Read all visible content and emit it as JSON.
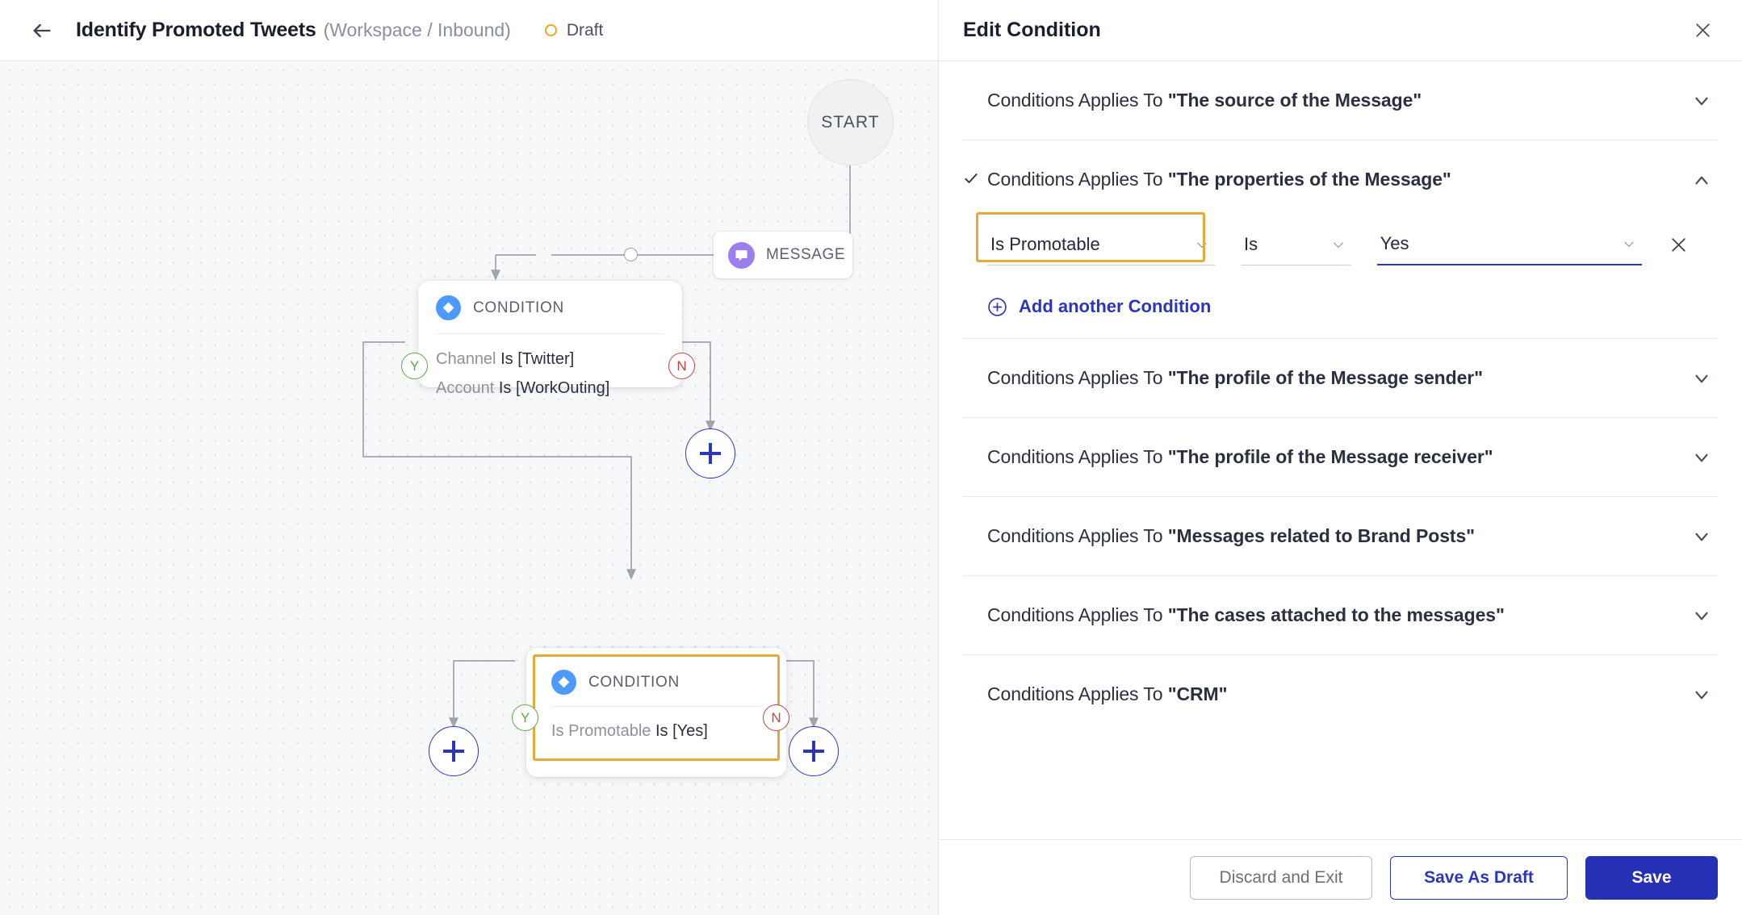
{
  "topbar": {
    "back_icon": "arrow-left-icon",
    "title": "Identify Promoted Tweets",
    "subtitle": "(Workspace / Inbound)",
    "status": "Draft",
    "status_color": "#e8a826"
  },
  "canvas": {
    "start_label": "START",
    "message_node": {
      "label": "MESSAGE",
      "icon": "chat-bubble-icon",
      "icon_color": "#9b7ff0"
    },
    "condition_node_1": {
      "title": "CONDITION",
      "icon": "diamond-icon",
      "icon_color": "#4c9aff",
      "rows": [
        {
          "field": "Channel",
          "expr": "Is [Twitter]"
        },
        {
          "field": "Account",
          "expr": "Is [WorkOuting]"
        }
      ],
      "yes_badge": "Y",
      "no_badge": "N"
    },
    "condition_node_2": {
      "title": "CONDITION",
      "icon": "diamond-icon",
      "icon_color": "#4c9aff",
      "rows": [
        {
          "field": "Is Promotable",
          "expr": "Is [Yes]"
        }
      ],
      "yes_badge": "Y",
      "no_badge": "N",
      "highlight_color": "#e7a93a"
    },
    "add_buttons": [
      {
        "name": "add-node-right-of-condition-1"
      },
      {
        "name": "add-node-under-yes-branch"
      },
      {
        "name": "add-node-under-no-branch"
      }
    ]
  },
  "panel": {
    "title": "Edit Condition",
    "close_icon": "close-icon",
    "accordions": [
      {
        "prefix": "Conditions Applies To ",
        "target": "\"The source of the Message\"",
        "expanded": false,
        "checked": false
      },
      {
        "prefix": "Conditions Applies To ",
        "target": "\"The properties of the Message\"",
        "expanded": true,
        "checked": true
      },
      {
        "prefix": "Conditions Applies To ",
        "target": "\"The profile of the Message sender\"",
        "expanded": false,
        "checked": false
      },
      {
        "prefix": "Conditions Applies To ",
        "target": "\"The profile of the Message receiver\"",
        "expanded": false,
        "checked": false
      },
      {
        "prefix": "Conditions Applies To ",
        "target": "\"Messages related to Brand Posts\"",
        "expanded": false,
        "checked": false
      },
      {
        "prefix": "Conditions Applies To ",
        "target": "\"The cases attached to the messages\"",
        "expanded": false,
        "checked": false
      },
      {
        "prefix": "Conditions Applies To ",
        "target": "\"CRM\"",
        "expanded": false,
        "checked": false
      }
    ],
    "condition_row": {
      "field_value": "Is Promotable",
      "operator_value": "Is",
      "value_value": "Yes",
      "remove_icon": "close-icon",
      "field_highlight_color": "#e7a93a",
      "value_underline_color": "#2b36b8"
    },
    "add_another": {
      "icon": "plus-circle-icon",
      "label": "Add another Condition"
    },
    "footer": {
      "discard_label": "Discard and Exit",
      "draft_label": "Save As Draft",
      "save_label": "Save",
      "save_color": "#2630b5"
    }
  }
}
